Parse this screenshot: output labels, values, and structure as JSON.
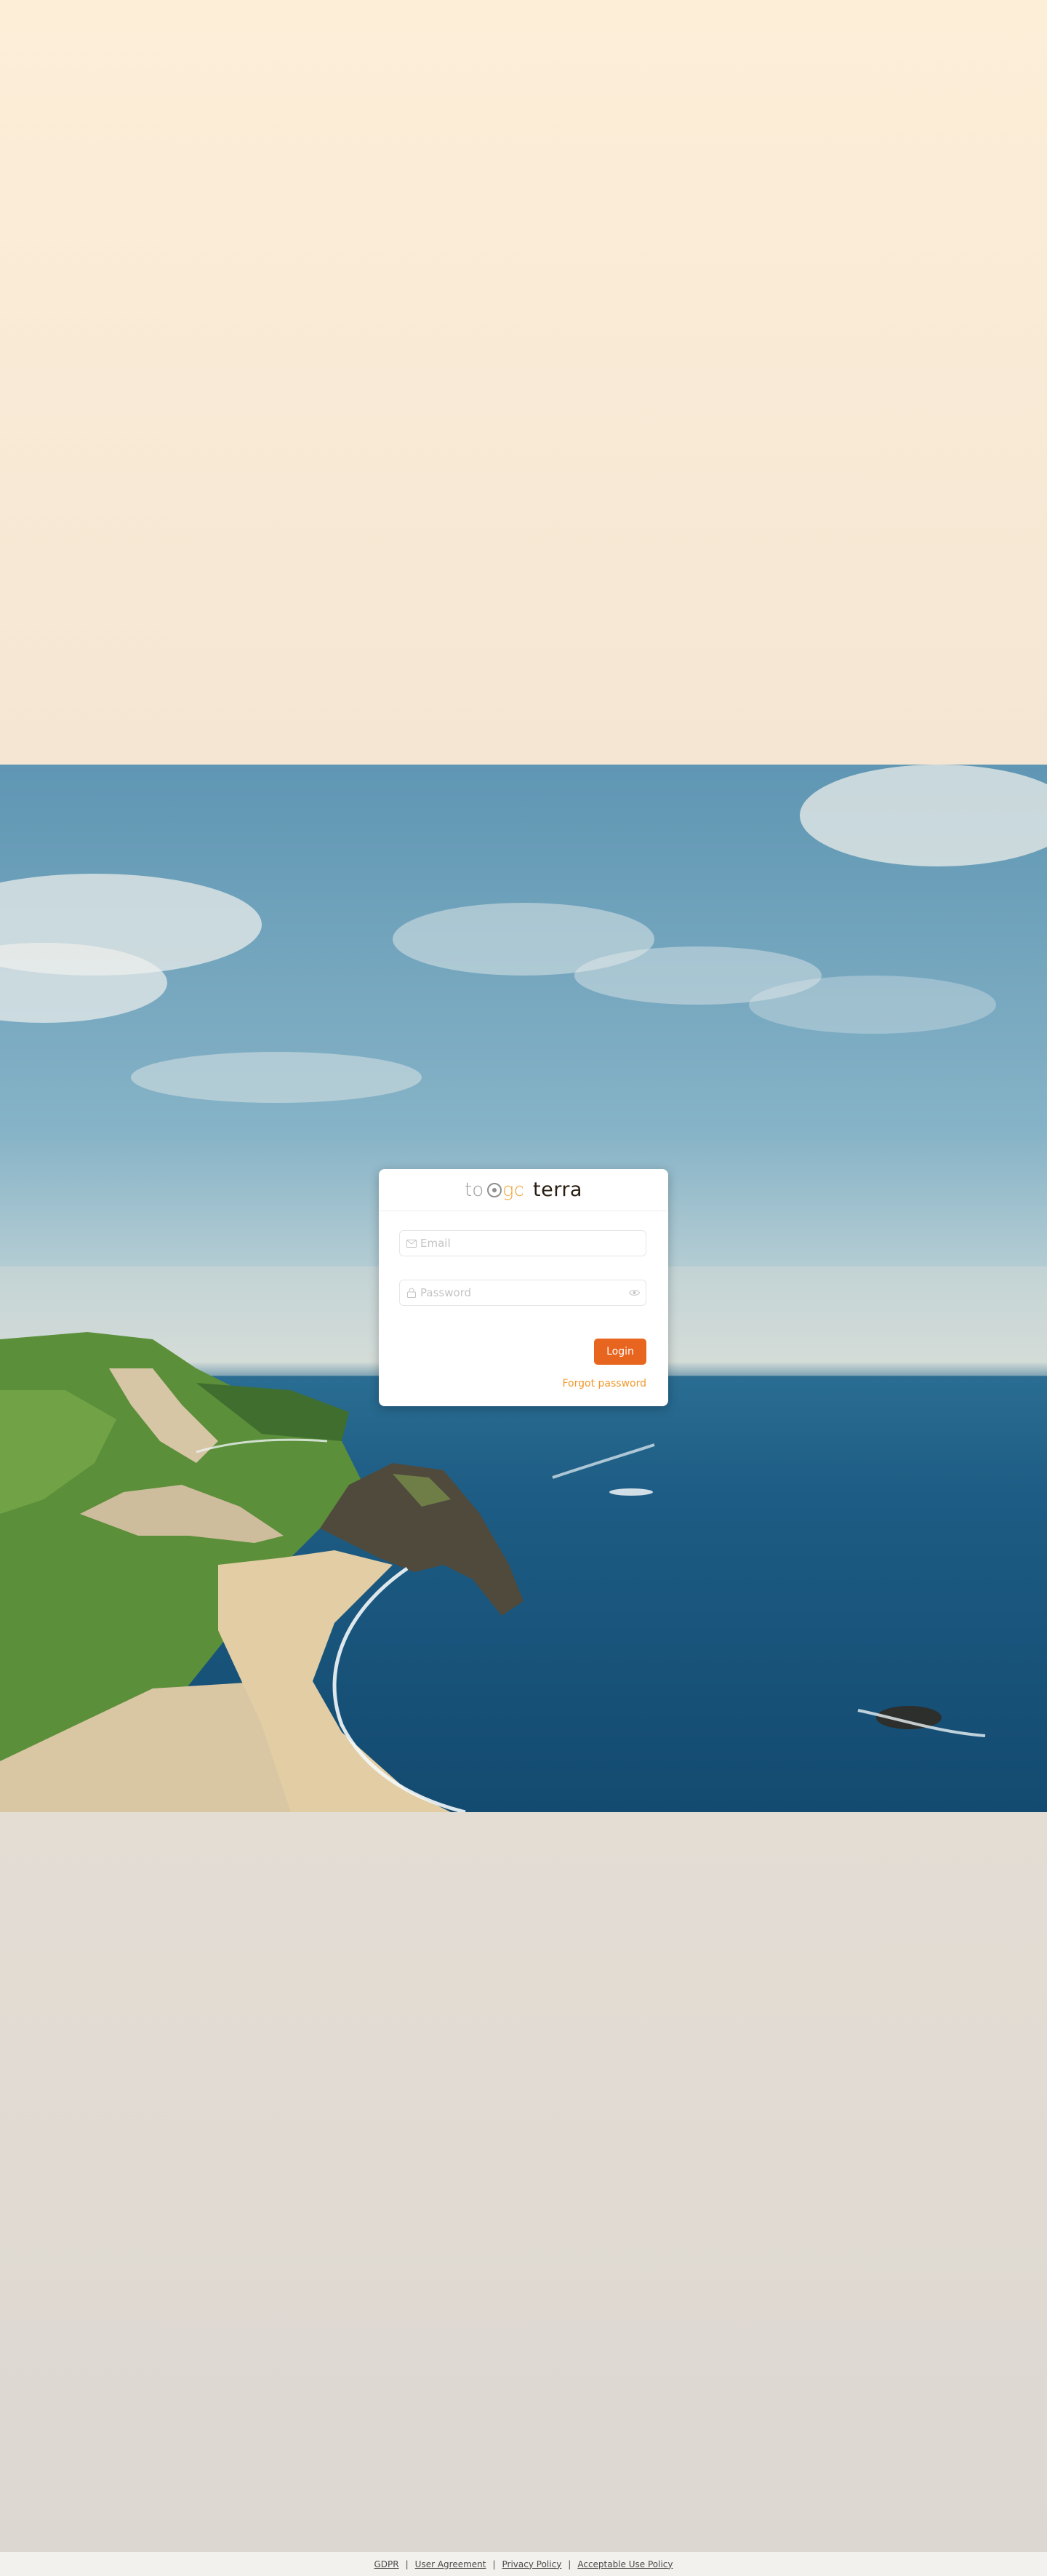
{
  "brand": {
    "logo_text": "toogo",
    "product_name": "terra"
  },
  "login_form": {
    "email": {
      "value": "",
      "placeholder": "Email",
      "icon": "mail-icon"
    },
    "password": {
      "value": "",
      "placeholder": "Password",
      "icon": "lock-icon",
      "toggle_icon": "eye-icon"
    },
    "login_label": "Login",
    "forgot_label": "Forgot password"
  },
  "footer": {
    "links": [
      "GDPR",
      "User Agreement",
      "Privacy Policy",
      "Acceptable Use Policy"
    ],
    "separator": "|"
  },
  "colors": {
    "accent": "#e8651f",
    "link": "#ef9a2e",
    "logo_grey": "#9a9a9a",
    "logo_orange": "#f0a53c"
  }
}
